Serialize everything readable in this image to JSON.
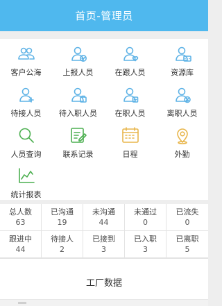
{
  "header": {
    "title": "首页-管理员"
  },
  "menu": [
    {
      "label": "客户公海",
      "icon": "customer-pool-icon",
      "color": "#5fb3e6"
    },
    {
      "label": "上报人员",
      "icon": "report-person-icon",
      "color": "#5fb3e6"
    },
    {
      "label": "在跟人员",
      "icon": "following-person-icon",
      "color": "#5fb3e6"
    },
    {
      "label": "资源库",
      "icon": "resource-library-icon",
      "color": "#5fb3e6"
    },
    {
      "label": "待接人员",
      "icon": "pending-pickup-icon",
      "color": "#5fb3e6"
    },
    {
      "label": "待入职人员",
      "icon": "pending-onboard-icon",
      "color": "#5fb3e6"
    },
    {
      "label": "在职人员",
      "icon": "employed-person-icon",
      "color": "#5fb3e6"
    },
    {
      "label": "离职人员",
      "icon": "resigned-person-icon",
      "color": "#5fb3e6"
    },
    {
      "label": "人员查询",
      "icon": "search-icon",
      "color": "#4caf50"
    },
    {
      "label": "联系记录",
      "icon": "edit-record-icon",
      "color": "#4caf50"
    },
    {
      "label": "日程",
      "icon": "calendar-icon",
      "color": "#e8b64c"
    },
    {
      "label": "外勤",
      "icon": "location-pin-icon",
      "color": "#e8b64c"
    },
    {
      "label": "统计报表",
      "icon": "line-chart-icon",
      "color": "#4caf50"
    }
  ],
  "stats": [
    {
      "label": "总人数",
      "value": "63"
    },
    {
      "label": "已沟通",
      "value": "19"
    },
    {
      "label": "未沟通",
      "value": "44"
    },
    {
      "label": "未通过",
      "value": "0"
    },
    {
      "label": "已流失",
      "value": "0"
    },
    {
      "label": "跟进中",
      "value": "44"
    },
    {
      "label": "待接人",
      "value": "2"
    },
    {
      "label": "已接到",
      "value": "3"
    },
    {
      "label": "已入职",
      "value": "3"
    },
    {
      "label": "已离职",
      "value": "5"
    }
  ],
  "factory": {
    "title": "工厂数据"
  }
}
